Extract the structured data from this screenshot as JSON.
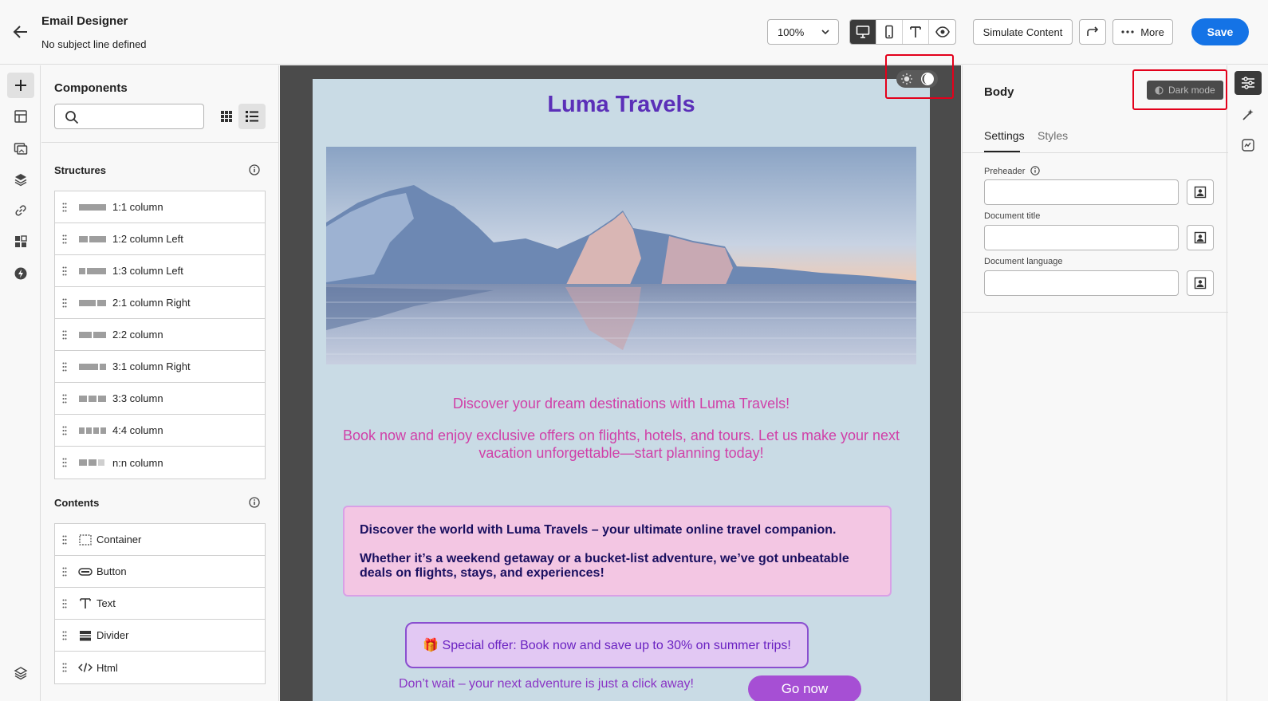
{
  "header": {
    "title": "Email Designer",
    "subtitle": "No subject line defined",
    "zoom": "100%",
    "simulate_label": "Simulate Content",
    "more_label": "More",
    "save_label": "Save"
  },
  "components": {
    "title": "Components",
    "search_placeholder": "",
    "structures_heading": "Structures",
    "structures": [
      {
        "label": "1:1 column"
      },
      {
        "label": "1:2 column Left"
      },
      {
        "label": "1:3 column Left"
      },
      {
        "label": "2:1 column Right"
      },
      {
        "label": "2:2 column"
      },
      {
        "label": "3:1 column Right"
      },
      {
        "label": "3:3 column"
      },
      {
        "label": "4:4 column"
      },
      {
        "label": "n:n column"
      }
    ],
    "contents_heading": "Contents",
    "contents": [
      {
        "label": "Container",
        "icon": "container-icon"
      },
      {
        "label": "Button",
        "icon": "button-icon"
      },
      {
        "label": "Text",
        "icon": "text-icon"
      },
      {
        "label": "Divider",
        "icon": "divider-icon"
      },
      {
        "label": "Html",
        "icon": "html-icon"
      }
    ]
  },
  "email": {
    "brand_title": "Luma Travels",
    "tagline": "Discover your dream destinations with Luma Travels!",
    "intro": "Book now and enjoy exclusive offers on flights, hotels, and tours. Let us make your next vacation unforgettable—start planning today!",
    "box_line1": "Discover the world with Luma Travels – your ultimate online travel companion.",
    "box_line2": "Whether it’s a weekend getaway or a bucket-list adventure, we’ve got unbeatable deals on flights, stays, and experiences!",
    "offer": "🎁 Special offer: Book now and save up to 30% on summer trips!",
    "cta_text": "Don’t wait – your next adventure is just a click away!",
    "cta_button": "Go now"
  },
  "properties": {
    "title": "Body",
    "dark_mode_label": "Dark mode",
    "tabs": [
      "Settings",
      "Styles"
    ],
    "fields": [
      {
        "label": "Preheader",
        "value": ""
      },
      {
        "label": "Document title",
        "value": ""
      },
      {
        "label": "Document language",
        "value": ""
      }
    ]
  },
  "colors": {
    "accent": "#1473e6",
    "email_bg": "#c9dbe5",
    "brand_purple": "#5b2fb8",
    "pink_text": "#d040a8",
    "highlight_frame": "#e3001b"
  }
}
